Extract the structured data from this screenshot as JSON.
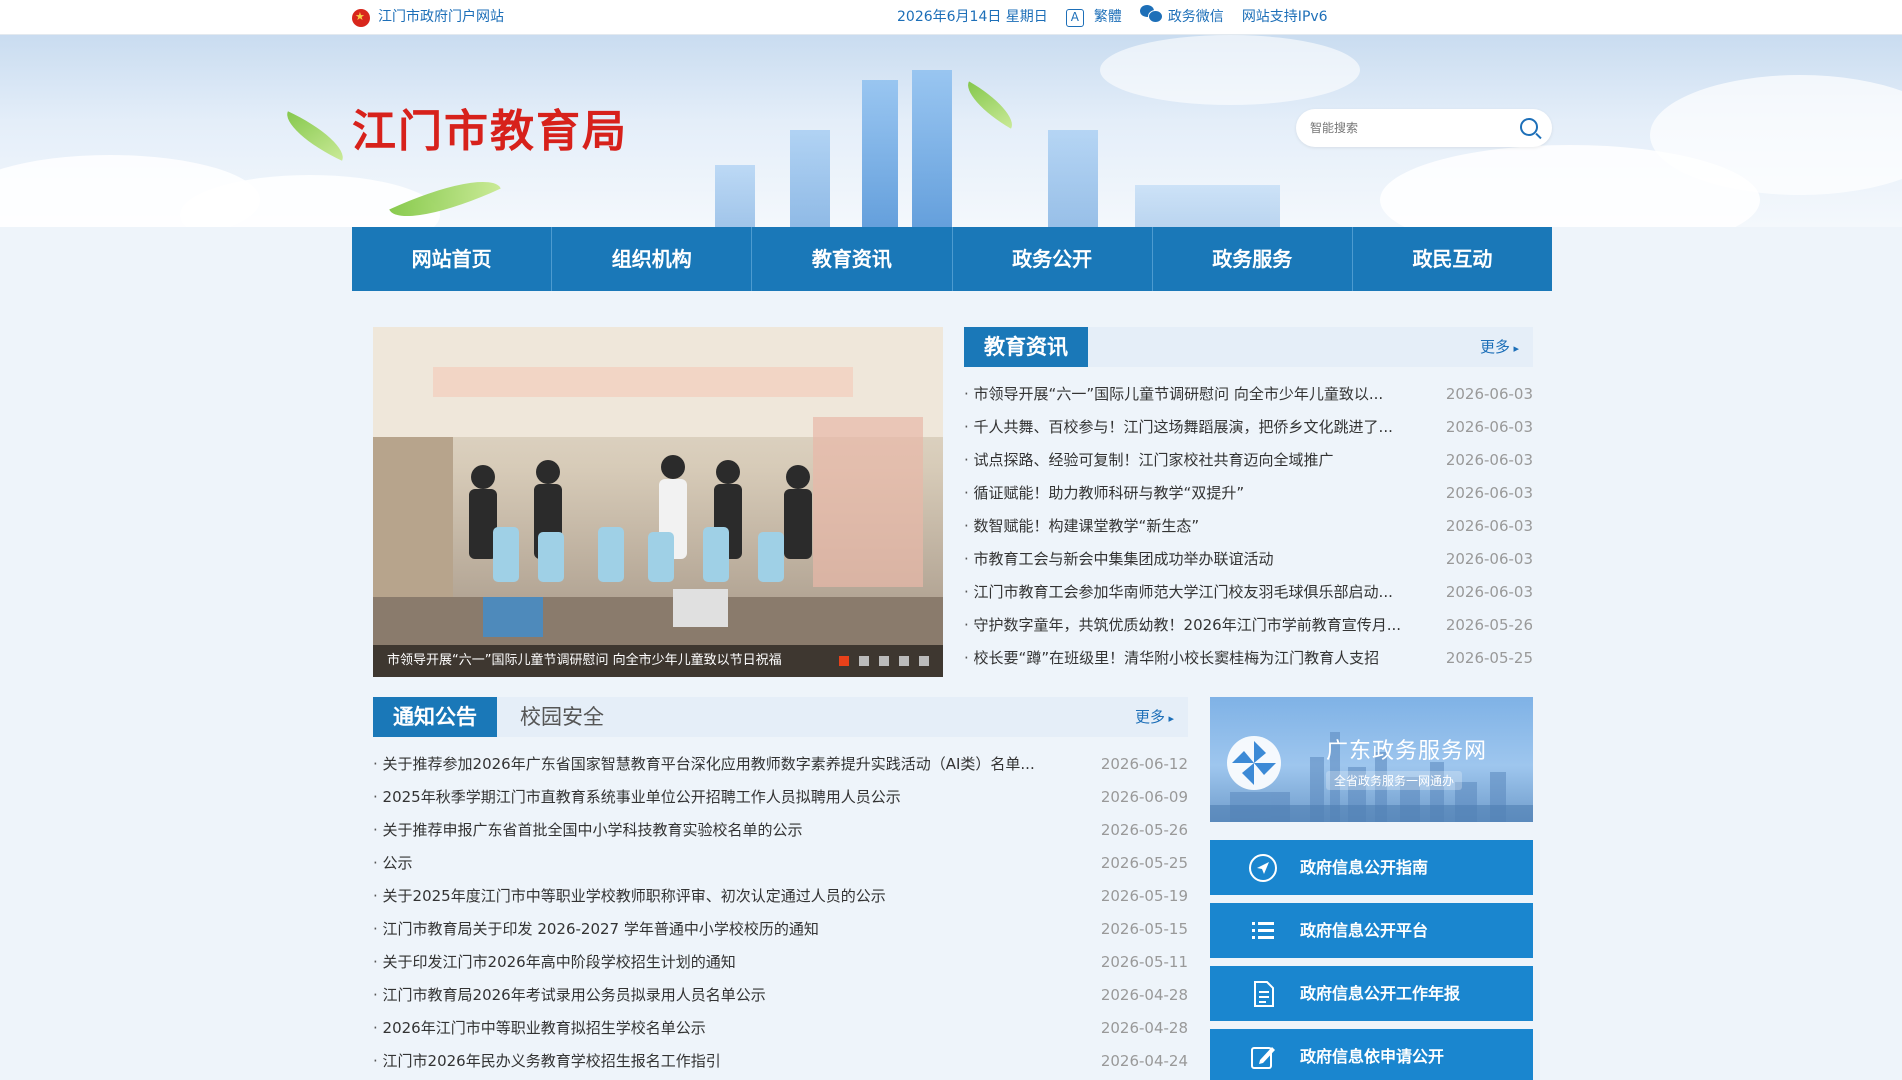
{
  "topbar": {
    "portal_link": "江门市政府门户网站",
    "date": "2026年6月14日 星期日",
    "traditional": "繁體",
    "wechat": "政务微信",
    "ipv6": "网站支持IPv6"
  },
  "header": {
    "title": "江门市教育局",
    "search_placeholder": "智能搜索"
  },
  "nav": {
    "items": [
      "网站首页",
      "组织机构",
      "教育资讯",
      "政务公开",
      "政务服务",
      "政民互动"
    ]
  },
  "slider": {
    "caption": "市领导开展“六一”国际儿童节调研慰问 向全市少年儿童致以节日祝福",
    "dots": 5,
    "active_dot": 1
  },
  "edu_news": {
    "tab": "教育资讯",
    "more": "更多",
    "items": [
      {
        "title": "市领导开展“六一”国际儿童节调研慰问 向全市少年儿童致以...",
        "date": "2026-06-03"
      },
      {
        "title": "千人共舞、百校参与！江门这场舞蹈展演，把侨乡文化跳进了...",
        "date": "2026-06-03"
      },
      {
        "title": "试点探路、经验可复制！江门家校社共育迈向全域推广",
        "date": "2026-06-03"
      },
      {
        "title": "循证赋能！助力教师科研与教学“双提升”",
        "date": "2026-06-03"
      },
      {
        "title": "数智赋能！构建课堂教学“新生态”",
        "date": "2026-06-03"
      },
      {
        "title": "市教育工会与新会中集集团成功举办联谊活动",
        "date": "2026-06-03"
      },
      {
        "title": "江门市教育工会参加华南师范大学江门校友羽毛球俱乐部启动...",
        "date": "2026-06-03"
      },
      {
        "title": "守护数字童年，共筑优质幼教！2026年江门市学前教育宣传月...",
        "date": "2026-05-26"
      },
      {
        "title": "校长要“蹲”在班级里！清华附小校长窦桂梅为江门教育人支招",
        "date": "2026-05-25"
      }
    ]
  },
  "notices": {
    "tab": "通知公告",
    "tab2": "校园安全",
    "more": "更多",
    "items": [
      {
        "title": "关于推荐参加2026年广东省国家智慧教育平台深化应用教师数字素养提升实践活动（AI类）名单...",
        "date": "2026-06-12"
      },
      {
        "title": "2025年秋季学期江门市直教育系统事业单位公开招聘工作人员拟聘用人员公示",
        "date": "2026-06-09"
      },
      {
        "title": "关于推荐申报广东省首批全国中小学科技教育实验校名单的公示",
        "date": "2026-05-26"
      },
      {
        "title": "公示",
        "date": "2026-05-25"
      },
      {
        "title": "关于2025年度江门市中等职业学校教师职称评审、初次认定通过人员的公示",
        "date": "2026-05-19"
      },
      {
        "title": "江门市教育局关于印发 2026-2027 学年普通中小学校校历的通知",
        "date": "2026-05-15"
      },
      {
        "title": "关于印发江门市2026年高中阶段学校招生计划的通知",
        "date": "2026-05-11"
      },
      {
        "title": "江门市教育局2026年考试录用公务员拟录用人员名单公示",
        "date": "2026-04-28"
      },
      {
        "title": "2026年江门市中等职业教育拟招生学校名单公示",
        "date": "2026-04-28"
      },
      {
        "title": "江门市2026年民办义务教育学校招生报名工作指引",
        "date": "2026-04-24"
      }
    ]
  },
  "sidebar": {
    "gdzw_title": "广东政务服务网",
    "gdzw_sub": "全省政务服务一网通办",
    "services": [
      {
        "label": "政府信息公开指南",
        "icon": "navigation-arrow-icon"
      },
      {
        "label": "政府信息公开平台",
        "icon": "list-icon"
      },
      {
        "label": "政府信息公开工作年报",
        "icon": "document-icon"
      },
      {
        "label": "政府信息依申请公开",
        "icon": "edit-icon"
      }
    ]
  },
  "colors": {
    "brand_blue": "#1a78b8",
    "title_red": "#d7211b",
    "active_dot": "#e8411a"
  }
}
